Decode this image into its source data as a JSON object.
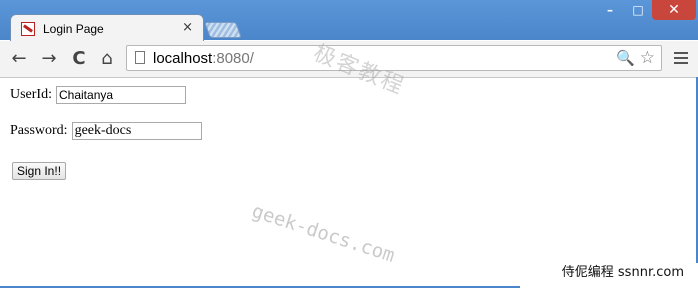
{
  "tab": {
    "title": "Login Page",
    "close": "×"
  },
  "window_controls": {
    "minimize": "–",
    "maximize": "□",
    "close": "✕"
  },
  "toolbar": {
    "back": "←",
    "forward": "→",
    "reload": "C",
    "home": "⌂",
    "url_host": "localhost",
    "url_rest": ":8080/",
    "zoom_icon": "🔍",
    "star_icon": "☆"
  },
  "form": {
    "userid_label": "UserId:",
    "userid_value": "Chaitanya",
    "password_label": "Password:",
    "password_value": "geek-docs",
    "submit_label": "Sign In!!"
  },
  "watermarks": {
    "chinese": "极客教程",
    "english": "geek-docs.com",
    "badge": "侍伲编程 ssnnr.com"
  },
  "colors": {
    "titlebar": "#4a86c9",
    "close_button": "#c9463d",
    "toolbar": "#f3f3f3"
  }
}
